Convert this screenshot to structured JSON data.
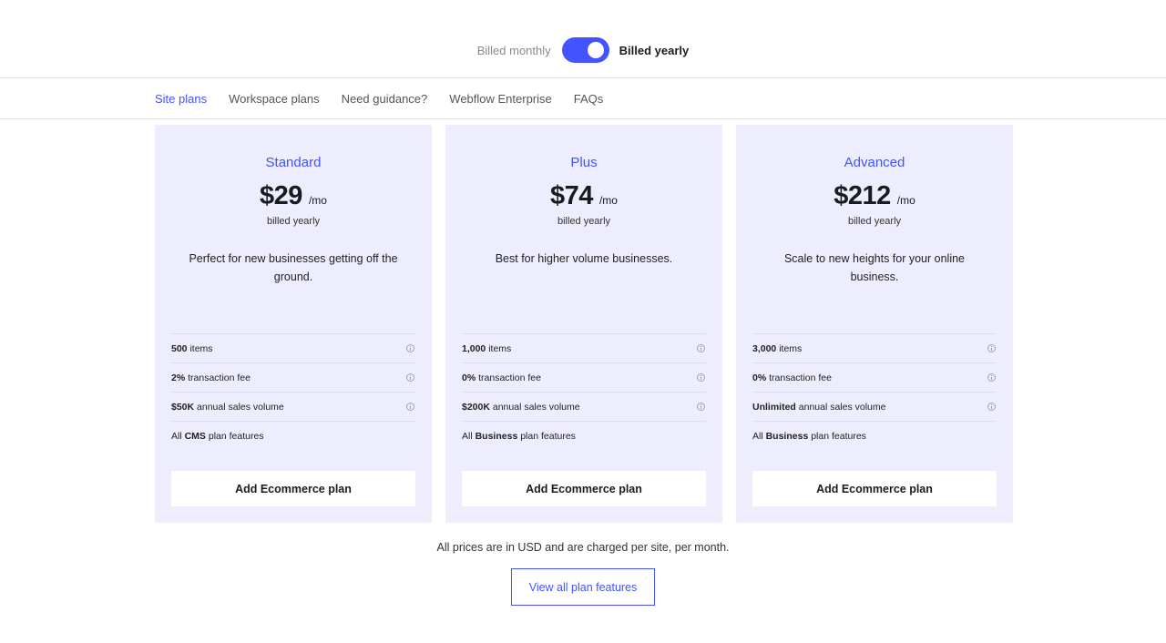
{
  "billing": {
    "monthly_label": "Billed monthly",
    "yearly_label": "Billed yearly"
  },
  "tabs": [
    {
      "label": "Site plans"
    },
    {
      "label": "Workspace plans"
    },
    {
      "label": "Need guidance?"
    },
    {
      "label": "Webflow Enterprise"
    },
    {
      "label": "FAQs"
    }
  ],
  "plans": [
    {
      "name": "Standard",
      "price": "$29",
      "per": "/mo",
      "billed": "billed yearly",
      "description": "Perfect for new businesses getting off the ground.",
      "features": [
        {
          "bold": "500",
          "text": " items"
        },
        {
          "bold": "2%",
          "text": " transaction fee"
        },
        {
          "bold": "$50K",
          "text": " annual sales volume"
        },
        {
          "pre": "All ",
          "bold": "CMS",
          "text": " plan features"
        }
      ],
      "cta": "Add Ecommerce plan"
    },
    {
      "name": "Plus",
      "price": "$74",
      "per": "/mo",
      "billed": "billed yearly",
      "description": "Best for higher volume businesses.",
      "features": [
        {
          "bold": "1,000",
          "text": " items"
        },
        {
          "bold": "0%",
          "text": " transaction fee"
        },
        {
          "bold": "$200K",
          "text": " annual sales volume"
        },
        {
          "pre": "All ",
          "bold": "Business",
          "text": " plan features"
        }
      ],
      "cta": "Add Ecommerce plan"
    },
    {
      "name": "Advanced",
      "price": "$212",
      "per": "/mo",
      "billed": "billed yearly",
      "description": "Scale to new heights for your online business.",
      "features": [
        {
          "bold": "3,000",
          "text": " items"
        },
        {
          "bold": "0%",
          "text": " transaction fee"
        },
        {
          "bold": "Unlimited",
          "text": " annual sales volume"
        },
        {
          "pre": "All ",
          "bold": "Business",
          "text": " plan features"
        }
      ],
      "cta": "Add Ecommerce plan"
    }
  ],
  "footer": {
    "note": "All prices are in USD and are charged per site, per month.",
    "view_all_label": "View all plan features"
  },
  "colors": {
    "accent": "#4353ff",
    "card_bg": "#ededfd"
  }
}
